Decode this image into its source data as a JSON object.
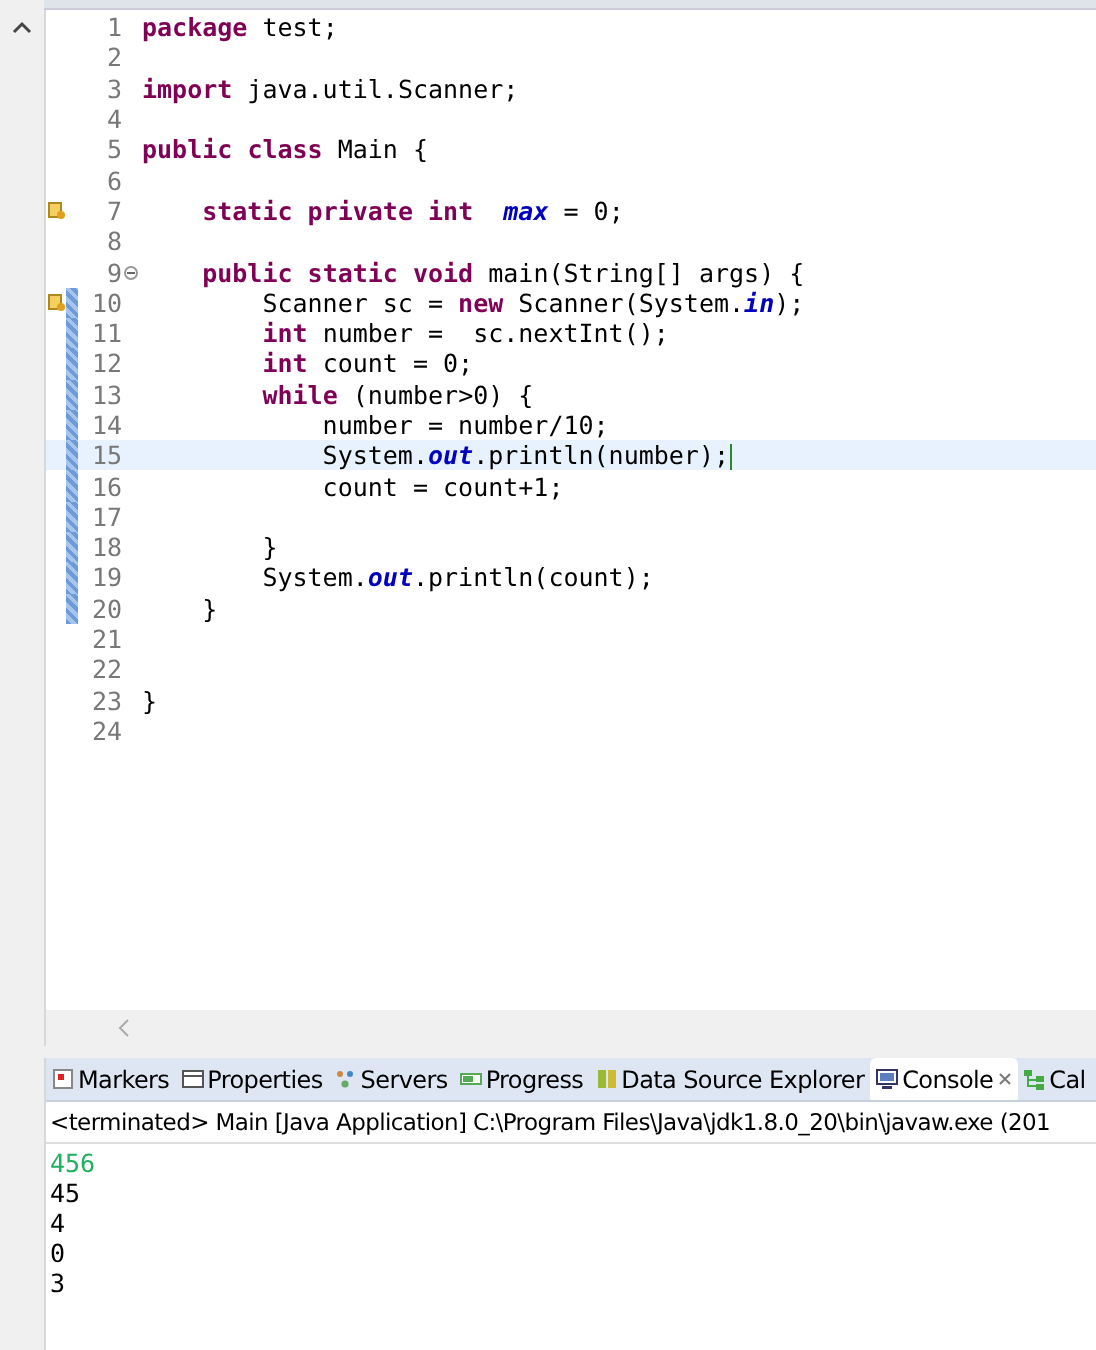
{
  "editor": {
    "lines": [
      {
        "number": "1",
        "warning": false,
        "changed": false,
        "current": false,
        "foldable": false,
        "text": "**package** test;"
      },
      {
        "number": "2",
        "warning": false,
        "changed": false,
        "current": false,
        "foldable": false
      },
      {
        "number": "3",
        "warning": false,
        "changed": false,
        "current": false,
        "foldable": false,
        "text": "**import** java.util.Scanner;"
      },
      {
        "number": "4",
        "warning": false,
        "changed": false,
        "current": false,
        "foldable": false
      },
      {
        "number": "5",
        "warning": false,
        "changed": false,
        "current": false,
        "foldable": false,
        "text": "**public** **class** Main {"
      },
      {
        "number": "6",
        "warning": false,
        "changed": false,
        "current": false,
        "foldable": false
      },
      {
        "number": "7",
        "warning": true,
        "changed": false,
        "current": false,
        "foldable": false,
        "text": "    **static** **private** **int**  *max* = 0;"
      },
      {
        "number": "8",
        "warning": false,
        "changed": false,
        "current": false,
        "foldable": false
      },
      {
        "number": "9",
        "warning": false,
        "changed": false,
        "current": false,
        "foldable": true,
        "text": "    **public** **static** **void** main(String[] args) {"
      },
      {
        "number": "10",
        "warning": true,
        "changed": true,
        "current": false,
        "foldable": false,
        "text": "        Scanner sc = **new** Scanner(System.*in*);"
      },
      {
        "number": "11",
        "warning": false,
        "changed": true,
        "current": false,
        "foldable": false,
        "text": "        **int** number =  sc.nextInt();"
      },
      {
        "number": "12",
        "warning": false,
        "changed": true,
        "current": false,
        "foldable": false,
        "text": "        **int** count = 0;"
      },
      {
        "number": "13",
        "warning": false,
        "changed": true,
        "current": false,
        "foldable": false,
        "text": "        **while** (number>0) {"
      },
      {
        "number": "14",
        "warning": false,
        "changed": true,
        "current": false,
        "foldable": false,
        "text": "            number = number/10;"
      },
      {
        "number": "15",
        "warning": false,
        "changed": true,
        "current": true,
        "foldable": false,
        "text": "            System.*out*.println(number);"
      },
      {
        "number": "16",
        "warning": false,
        "changed": true,
        "current": false,
        "foldable": false,
        "text": "            count = count+1;"
      },
      {
        "number": "17",
        "warning": false,
        "changed": true,
        "current": false,
        "foldable": false
      },
      {
        "number": "18",
        "warning": false,
        "changed": true,
        "current": false,
        "foldable": false,
        "text": "        }"
      },
      {
        "number": "19",
        "warning": false,
        "changed": true,
        "current": false,
        "foldable": false,
        "text": "        System.*out*.println(count);"
      },
      {
        "number": "20",
        "warning": false,
        "changed": true,
        "current": false,
        "foldable": false,
        "text": "    }"
      },
      {
        "number": "21",
        "warning": false,
        "changed": false,
        "current": false,
        "foldable": false
      },
      {
        "number": "22",
        "warning": false,
        "changed": false,
        "current": false,
        "foldable": false
      },
      {
        "number": "23",
        "warning": false,
        "changed": false,
        "current": false,
        "foldable": false,
        "text": "}"
      },
      {
        "number": "24",
        "warning": false,
        "changed": false,
        "current": false,
        "foldable": false
      }
    ]
  },
  "panel": {
    "tabs": [
      {
        "label": "Markers",
        "selected": false
      },
      {
        "label": "Properties",
        "selected": false
      },
      {
        "label": "Servers",
        "selected": false
      },
      {
        "label": "Progress",
        "selected": false
      },
      {
        "label": "Data Source Explorer",
        "selected": false
      },
      {
        "label": "Console",
        "selected": true
      },
      {
        "label": "Cal",
        "selected": false
      }
    ],
    "console_header": "<terminated> Main [Java Application] C:\\Program Files\\Java\\jdk1.8.0_20\\bin\\javaw.exe (201",
    "output": [
      {
        "text": "456",
        "kind": "input"
      },
      {
        "text": "45",
        "kind": "output"
      },
      {
        "text": "4",
        "kind": "output"
      },
      {
        "text": "0",
        "kind": "output"
      },
      {
        "text": "3",
        "kind": "output"
      }
    ]
  }
}
